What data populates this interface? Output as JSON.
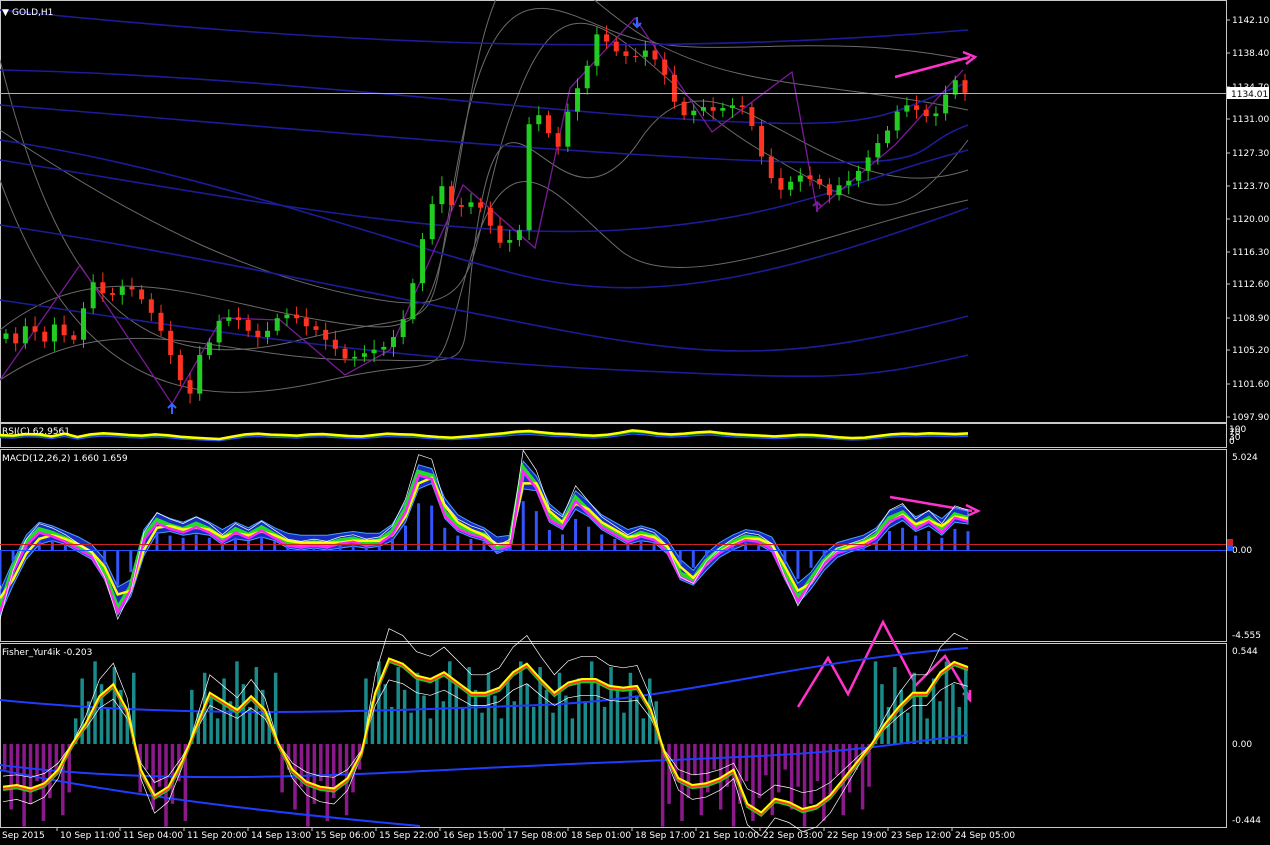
{
  "window": {
    "symbol_title": "GOLD,H1",
    "title_arrow": "▼"
  },
  "panes": {
    "main": {
      "price_ticks": [
        "1142.10",
        "1138.40",
        "1134.70",
        "1131.00",
        "1127.30",
        "1123.70",
        "1120.00",
        "1116.30",
        "1112.60",
        "1108.90",
        "1105.20",
        "1101.60",
        "1097.90"
      ],
      "current_price": "1134.01"
    },
    "rsi": {
      "label": "RSI(C) 62.9561",
      "ticks": [
        "100",
        "70",
        "30",
        "0"
      ]
    },
    "macd": {
      "label": "MACD(12,26,2) 1.660 1.659",
      "ticks": [
        "5.024",
        "0.00",
        "-4.555"
      ]
    },
    "fisher": {
      "label": "Fisher_Yur4ik -0.203",
      "ticks": [
        "0.544",
        "0.00",
        "-0.444"
      ]
    }
  },
  "time_axis": [
    "Sep 2015",
    "10 Sep 11:00",
    "11 Sep 04:00",
    "11 Sep 20:00",
    "14 Sep 13:00",
    "15 Sep 06:00",
    "15 Sep 22:00",
    "16 Sep 15:00",
    "17 Sep 08:00",
    "18 Sep 01:00",
    "18 Sep 17:00",
    "21 Sep 10:00",
    "22 Sep 03:00",
    "22 Sep 19:00",
    "23 Sep 12:00",
    "24 Sep 05:00"
  ],
  "colors": {
    "background": "#000000",
    "bull_candle": "#22cc22",
    "bear_candle": "#ff3322",
    "ma_blue": "#1c1c99",
    "band_grey": "#6a6a6a",
    "zigzag": "#7a1a99",
    "arrow_blue": "#3366ff",
    "annotation_magenta": "#ff33cc",
    "rsi_yellow": "#ffff00",
    "macd_fill": "#1e3cff",
    "fisher_teal": "#1a8a8a",
    "fisher_purple": "#8a1a8a"
  },
  "chart_data": [
    {
      "type": "candlestick",
      "title": "GOLD,H1",
      "ylim": [
        1097.9,
        1142.1
      ],
      "close": [
        1107.2,
        1106.1,
        1108.0,
        1107.4,
        1106.3,
        1108.2,
        1107.0,
        1106.5,
        1110.0,
        1112.9,
        1111.7,
        1111.5,
        1112.4,
        1112.1,
        1111.0,
        1109.5,
        1107.5,
        1104.8,
        1102.0,
        1100.5,
        1104.8,
        1106.2,
        1108.6,
        1109.0,
        1108.7,
        1107.5,
        1106.8,
        1107.5,
        1108.9,
        1109.3,
        1108.9,
        1108.0,
        1107.6,
        1106.5,
        1105.5,
        1104.4,
        1104.6,
        1105.0,
        1105.4,
        1105.7,
        1106.8,
        1108.8,
        1112.8,
        1117.7,
        1121.6,
        1123.6,
        1121.5,
        1121.3,
        1121.8,
        1121.2,
        1119.2,
        1117.3,
        1117.6,
        1118.7,
        1130.5,
        1131.5,
        1129.5,
        1128.0,
        1131.9,
        1134.5,
        1137.0,
        1140.5,
        1139.7,
        1138.6,
        1138.1,
        1138.0,
        1138.7,
        1137.7,
        1136.0,
        1133.0,
        1131.5,
        1132.0,
        1132.4,
        1132.0,
        1132.3,
        1132.6,
        1132.4,
        1130.3,
        1126.9,
        1124.5,
        1123.2,
        1124.1,
        1124.8,
        1124.4,
        1123.8,
        1122.6,
        1123.7,
        1124.2,
        1125.3,
        1126.8,
        1128.4,
        1129.8,
        1131.9,
        1132.6,
        1132.1,
        1131.4,
        1131.7,
        1133.8,
        1135.4,
        1134.0
      ],
      "high_low": {
        "max_high": 1141.8,
        "min_low": 1098.5
      }
    },
    {
      "type": "line",
      "title": "RSI(C) 62.9561",
      "ylim": [
        0,
        100
      ],
      "series": [
        {
          "name": "RSI",
          "values": [
            55,
            52,
            60,
            58,
            48,
            62,
            45,
            58,
            64,
            60,
            55,
            52,
            58,
            54,
            46,
            42,
            38,
            35,
            47,
            58,
            62,
            57,
            55,
            52,
            58,
            60,
            55,
            50,
            48,
            55,
            62,
            59,
            57,
            50,
            45,
            42,
            47,
            52,
            58,
            64,
            72,
            75,
            68,
            62,
            60,
            55,
            52,
            56,
            66,
            78,
            72,
            62,
            58,
            62,
            68,
            72,
            64,
            58,
            55,
            52,
            48,
            52,
            56,
            55,
            50,
            44,
            40,
            42,
            50,
            58,
            62,
            60,
            64,
            62,
            60,
            63
          ]
        }
      ]
    },
    {
      "type": "line",
      "title": "MACD(12,26,2) 1.660 1.659",
      "ylim": [
        -4.555,
        5.024
      ],
      "series": [
        {
          "name": "MACD",
          "values": [
            -3.2,
            -1.0,
            0.4,
            1.1,
            0.9,
            0.6,
            0.2,
            -0.2,
            -1.3,
            -3.2,
            -2.0,
            0.7,
            1.6,
            1.3,
            1.1,
            1.4,
            1.1,
            0.6,
            1.1,
            0.8,
            1.2,
            0.8,
            0.4,
            0.3,
            0.4,
            0.3,
            0.5,
            0.6,
            0.4,
            0.5,
            1.0,
            2.2,
            4.2,
            4.0,
            2.0,
            1.3,
            1.0,
            0.8,
            0.1,
            0.4,
            4.4,
            3.5,
            1.8,
            1.4,
            2.8,
            2.1,
            1.4,
            1.0,
            0.6,
            0.9,
            0.7,
            0.1,
            -1.3,
            -1.6,
            -0.6,
            0.0,
            0.4,
            0.7,
            0.6,
            0.2,
            -1.3,
            -2.6,
            -1.6,
            -0.6,
            0.0,
            0.2,
            0.4,
            0.8,
            1.7,
            2.0,
            1.3,
            1.7,
            1.1,
            1.9,
            1.7
          ]
        },
        {
          "name": "Signal",
          "values": [
            -2.6,
            -1.6,
            -0.2,
            0.6,
            0.8,
            0.6,
            0.3,
            -0.1,
            -0.9,
            -2.4,
            -2.2,
            0.0,
            1.2,
            1.3,
            1.1,
            1.2,
            1.1,
            0.7,
            0.9,
            0.8,
            1.0,
            0.8,
            0.5,
            0.4,
            0.4,
            0.4,
            0.4,
            0.5,
            0.5,
            0.5,
            0.8,
            1.8,
            3.6,
            3.9,
            2.4,
            1.5,
            1.1,
            0.8,
            0.3,
            0.4,
            3.6,
            3.6,
            2.1,
            1.5,
            2.5,
            2.2,
            1.5,
            1.1,
            0.7,
            0.8,
            0.7,
            0.2,
            -0.9,
            -1.5,
            -0.8,
            -0.1,
            0.3,
            0.6,
            0.6,
            0.3,
            -0.9,
            -2.2,
            -1.8,
            -0.8,
            -0.1,
            0.2,
            0.4,
            0.7,
            1.5,
            1.9,
            1.4,
            1.6,
            1.3,
            1.8,
            1.7
          ]
        }
      ]
    },
    {
      "type": "line",
      "title": "Fisher_Yur4ik -0.203",
      "ylim": [
        -0.444,
        0.544
      ],
      "series": [
        {
          "name": "Fisher",
          "values": [
            -0.25,
            -0.24,
            -0.26,
            -0.23,
            -0.15,
            0.0,
            0.12,
            0.28,
            0.35,
            0.2,
            -0.15,
            -0.3,
            -0.25,
            -0.1,
            0.1,
            0.3,
            0.25,
            0.2,
            0.28,
            0.2,
            0.0,
            -0.15,
            -0.22,
            -0.25,
            -0.26,
            -0.2,
            -0.05,
            0.3,
            0.5,
            0.47,
            0.4,
            0.38,
            0.42,
            0.36,
            0.3,
            0.3,
            0.33,
            0.42,
            0.47,
            0.38,
            0.3,
            0.36,
            0.38,
            0.38,
            0.34,
            0.33,
            0.34,
            0.2,
            -0.05,
            -0.2,
            -0.24,
            -0.23,
            -0.2,
            -0.15,
            -0.35,
            -0.4,
            -0.32,
            -0.34,
            -0.38,
            -0.36,
            -0.3,
            -0.2,
            -0.1,
            0.0,
            0.12,
            0.22,
            0.3,
            0.3,
            0.42,
            0.48,
            0.45
          ]
        }
      ]
    }
  ]
}
